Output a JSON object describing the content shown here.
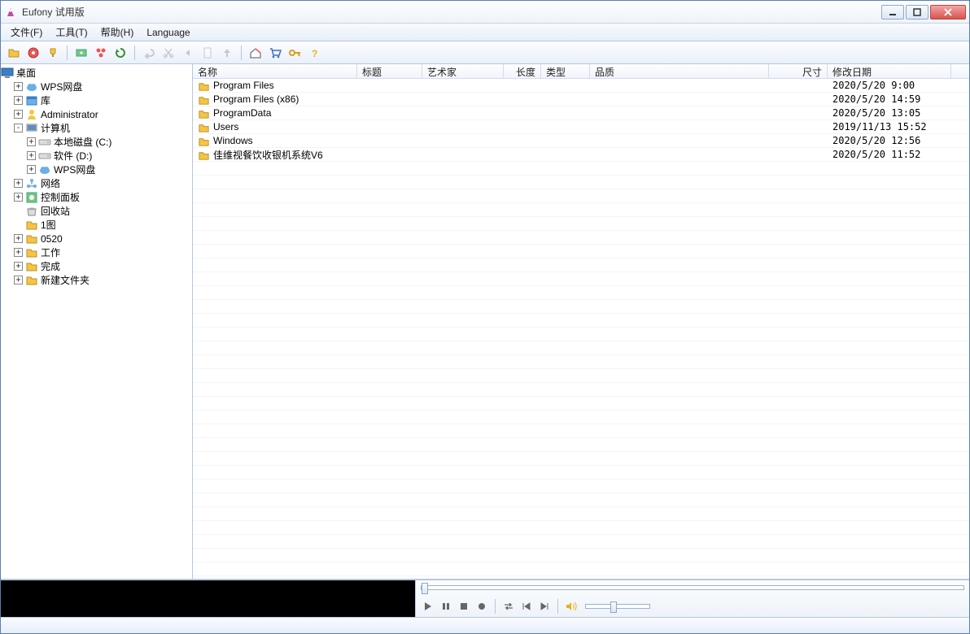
{
  "window": {
    "title": "Eufony 试用版"
  },
  "menu": {
    "file": "文件(F)",
    "tools": "工具(T)",
    "help": "帮助(H)",
    "language": "Language"
  },
  "tree": {
    "root": "桌面",
    "items": [
      {
        "label": "WPS网盘",
        "depth": 1,
        "icon": "cloud",
        "twisty": "+"
      },
      {
        "label": "库",
        "depth": 1,
        "icon": "lib",
        "twisty": "+"
      },
      {
        "label": "Administrator",
        "depth": 1,
        "icon": "user",
        "twisty": "+"
      },
      {
        "label": "计算机",
        "depth": 1,
        "icon": "computer",
        "twisty": "-"
      },
      {
        "label": "本地磁盘 (C:)",
        "depth": 2,
        "icon": "drive",
        "twisty": "+"
      },
      {
        "label": "软件 (D:)",
        "depth": 2,
        "icon": "drive",
        "twisty": "+"
      },
      {
        "label": "WPS网盘",
        "depth": 2,
        "icon": "cloud",
        "twisty": "+"
      },
      {
        "label": "网络",
        "depth": 1,
        "icon": "network",
        "twisty": "+"
      },
      {
        "label": "控制面板",
        "depth": 1,
        "icon": "control",
        "twisty": "+"
      },
      {
        "label": "回收站",
        "depth": 1,
        "icon": "recycle",
        "twisty": " "
      },
      {
        "label": "1图",
        "depth": 1,
        "icon": "folder",
        "twisty": " "
      },
      {
        "label": "0520",
        "depth": 1,
        "icon": "folder",
        "twisty": "+"
      },
      {
        "label": "工作",
        "depth": 1,
        "icon": "folder",
        "twisty": "+"
      },
      {
        "label": "完成",
        "depth": 1,
        "icon": "folder",
        "twisty": "+"
      },
      {
        "label": "新建文件夹",
        "depth": 1,
        "icon": "folder",
        "twisty": "+"
      }
    ]
  },
  "columns": {
    "name": "名称",
    "title": "标题",
    "artist": "艺术家",
    "length": "长度",
    "type": "类型",
    "quality": "品质",
    "size": "尺寸",
    "modified": "修改日期"
  },
  "column_widths": {
    "name": 202,
    "title": 80,
    "artist": 100,
    "length": 46,
    "type": 60,
    "quality": 220,
    "size": 72,
    "modified": 152
  },
  "files": [
    {
      "name": "Program Files",
      "modified": "2020/5/20 9:00"
    },
    {
      "name": "Program Files (x86)",
      "modified": "2020/5/20 14:59"
    },
    {
      "name": "ProgramData",
      "modified": "2020/5/20 13:05"
    },
    {
      "name": "Users",
      "modified": "2019/11/13 15:52"
    },
    {
      "name": "Windows",
      "modified": "2020/5/20 12:56"
    },
    {
      "name": "佳维视餐饮收银机系统V6",
      "modified": "2020/5/20 11:52"
    }
  ],
  "colors": {
    "accent": "#5a7faf",
    "close": "#d9534f"
  }
}
